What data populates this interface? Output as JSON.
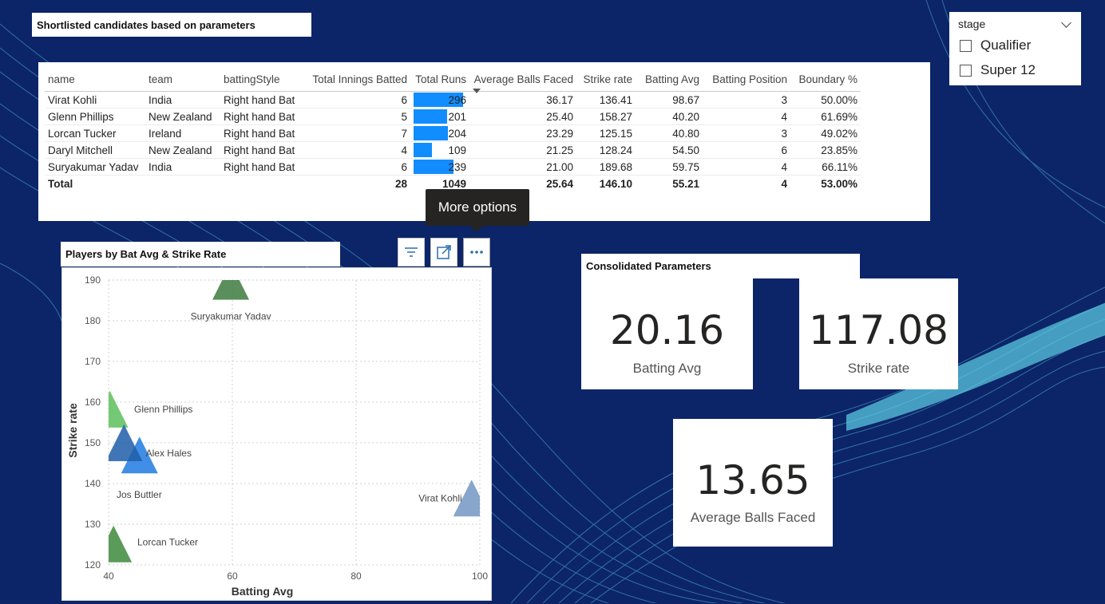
{
  "colors": {
    "background": "#0c2568",
    "bar": "#118dff",
    "accent_wave": "#5ed0e8"
  },
  "table": {
    "title": "Shortlisted candidates based on parameters",
    "columns": [
      "name",
      "team",
      "battingStyle",
      "Total Innings Batted",
      "Total Runs",
      "Average Balls Faced",
      "Strike rate",
      "Batting Avg",
      "Batting Position",
      "Boundary %"
    ],
    "rows": [
      [
        "Virat Kohli",
        "India",
        "Right hand Bat",
        "6",
        "296",
        "36.17",
        "136.41",
        "98.67",
        "3",
        "50.00%"
      ],
      [
        "Glenn Phillips",
        "New Zealand",
        "Right hand Bat",
        "5",
        "201",
        "25.40",
        "158.27",
        "40.20",
        "4",
        "61.69%"
      ],
      [
        "Lorcan Tucker",
        "Ireland",
        "Right hand Bat",
        "7",
        "204",
        "23.29",
        "125.15",
        "40.80",
        "3",
        "49.02%"
      ],
      [
        "Daryl Mitchell",
        "New Zealand",
        "Right hand Bat",
        "4",
        "109",
        "21.25",
        "128.24",
        "54.50",
        "6",
        "23.85%"
      ],
      [
        "Suryakumar Yadav",
        "India",
        "Right hand Bat",
        "6",
        "239",
        "21.00",
        "189.68",
        "59.75",
        "4",
        "66.11%"
      ]
    ],
    "total": [
      "Total",
      "",
      "",
      "28",
      "1049",
      "25.64",
      "146.10",
      "55.21",
      "4",
      "53.00%"
    ],
    "runs_bar_max": 296
  },
  "slicer": {
    "title": "stage",
    "options": [
      "Qualifier",
      "Super 12"
    ]
  },
  "tooltip": {
    "text": "More options"
  },
  "visual_header": {
    "icons": [
      "filter-icon",
      "focus-mode-icon",
      "more-options-icon"
    ]
  },
  "scatter": {
    "title": "Players by Bat Avg & Strike Rate"
  },
  "chart_data": {
    "type": "scatter",
    "title": "Players by Bat Avg & Strike Rate",
    "xlabel": "Batting Avg",
    "ylabel": "Strike rate",
    "xlim": [
      40,
      100
    ],
    "ylim": [
      120,
      190
    ],
    "xticks": [
      "40",
      "60",
      "80",
      "100"
    ],
    "yticks": [
      "120",
      "130",
      "140",
      "150",
      "160",
      "170",
      "180",
      "190"
    ],
    "grid": true,
    "points": [
      {
        "name": "Suryakumar Yadav",
        "x": 59.75,
        "y": 189.68,
        "color": "#3d7a3d"
      },
      {
        "name": "Glenn Phillips",
        "x": 40.2,
        "y": 158.27,
        "color": "#5cbf5c"
      },
      {
        "name": "Alex Hales",
        "x": 45,
        "y": 147,
        "color": "#1f7ae0"
      },
      {
        "name": "Jos Buttler",
        "x": 42.5,
        "y": 150,
        "color": "#1f5ea8"
      },
      {
        "name": "Virat Kohli",
        "x": 98.67,
        "y": 136.41,
        "color": "#7396c2"
      },
      {
        "name": "Lorcan Tucker",
        "x": 40.8,
        "y": 125.15,
        "color": "#3d8a3d"
      }
    ]
  },
  "consolidated": {
    "title": "Consolidated Parameters",
    "kpis": [
      {
        "value": "20.16",
        "label": "Batting Avg"
      },
      {
        "value": "117.08",
        "label": "Strike rate"
      },
      {
        "value": "13.65",
        "label": "Average Balls Faced"
      }
    ]
  }
}
